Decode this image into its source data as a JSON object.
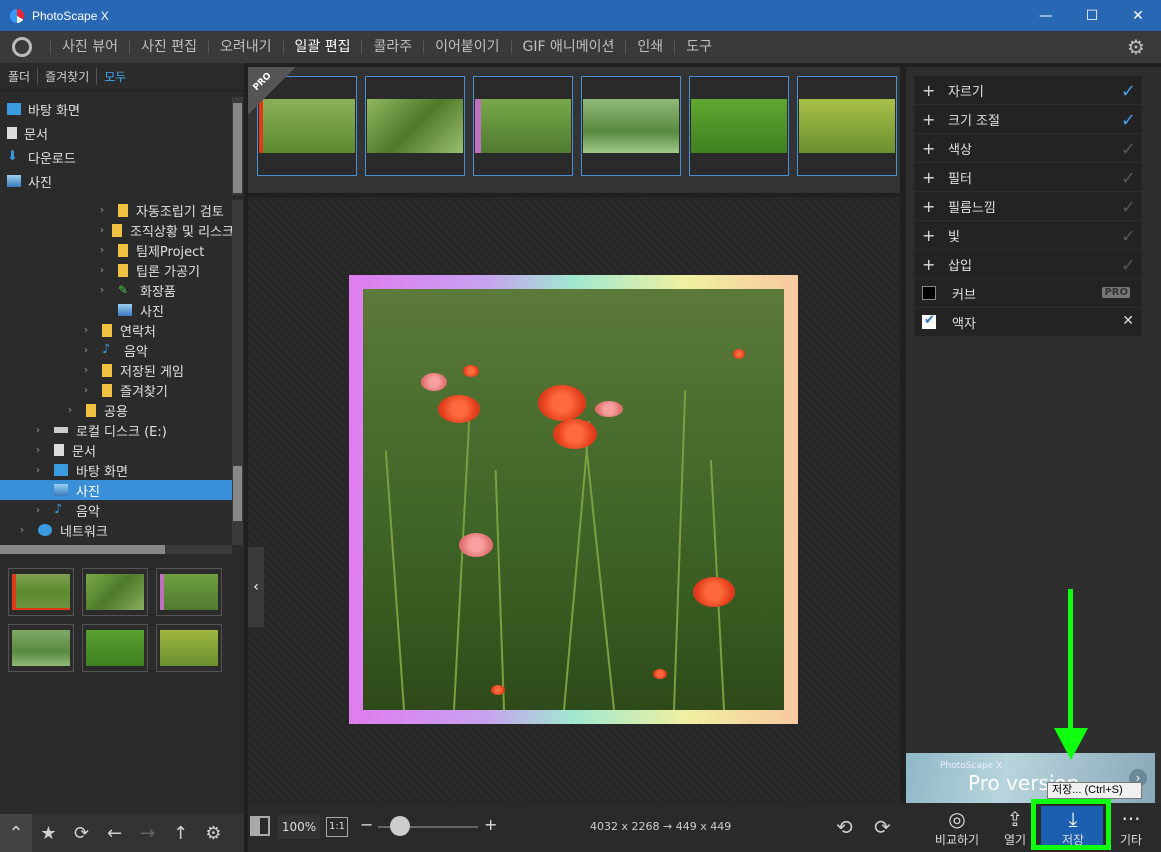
{
  "window": {
    "title": "PhotoScape X",
    "minimize": "—",
    "maximize": "☐",
    "close": "✕"
  },
  "menu": {
    "items": [
      {
        "label": "사진 뷰어"
      },
      {
        "label": "사진 편집"
      },
      {
        "label": "오려내기"
      },
      {
        "label": "일괄 편집"
      },
      {
        "label": "콜라주"
      },
      {
        "label": "이어붙이기"
      },
      {
        "label": "GIF 애니메이션"
      },
      {
        "label": "인쇄"
      },
      {
        "label": "도구"
      }
    ],
    "active": "일괄 편집"
  },
  "left": {
    "tabs": [
      "폴더",
      "즐겨찾기",
      "모두"
    ],
    "quick": [
      {
        "label": "바탕 화면",
        "icon": "desktop-icon"
      },
      {
        "label": "문서",
        "icon": "document-icon"
      },
      {
        "label": "다운로드",
        "icon": "download-icon"
      },
      {
        "label": "사진",
        "icon": "pictures-icon"
      }
    ],
    "tree": [
      {
        "label": "자동조립기 검토",
        "indent": 6
      },
      {
        "label": "조직상황 및 리스크",
        "indent": 6
      },
      {
        "label": "팀제Project",
        "indent": 6
      },
      {
        "label": "팁론 가공기",
        "indent": 6
      },
      {
        "label": "화장품",
        "indent": 6
      },
      {
        "label": "사진",
        "indent": 5
      },
      {
        "label": "연락처",
        "indent": 5
      },
      {
        "label": "음악",
        "indent": 5
      },
      {
        "label": "저장된 게임",
        "indent": 5
      },
      {
        "label": "즐겨찾기",
        "indent": 5
      },
      {
        "label": "공용",
        "indent": 4
      },
      {
        "label": "로컬 디스크 (E:)",
        "indent": 2
      },
      {
        "label": "문서",
        "indent": 2
      },
      {
        "label": "바탕 화면",
        "indent": 2
      },
      {
        "label": "사진",
        "indent": 2
      },
      {
        "label": "음악",
        "indent": 2
      },
      {
        "label": "네트워크",
        "indent": 1
      }
    ]
  },
  "adjustments": [
    {
      "label": "자르기",
      "checked": true
    },
    {
      "label": "크기 조절",
      "checked": true
    },
    {
      "label": "색상",
      "checked": false
    },
    {
      "label": "필터",
      "checked": false
    },
    {
      "label": "필름느낌",
      "checked": false
    },
    {
      "label": "빛",
      "checked": false
    },
    {
      "label": "삽입",
      "checked": false
    }
  ],
  "curve": {
    "label": "커브",
    "badge": "PRO"
  },
  "frame_option": {
    "label": "액자"
  },
  "pro_banner": {
    "small": "PhotoScape X",
    "big": "Pro version"
  },
  "bottom": {
    "zoom": "100%",
    "one_to_one": "1:1",
    "dimensions": "4032 x 2268 → 449 x 449",
    "compare": "비교하기",
    "open": "열기",
    "save": "저장",
    "more": "기타",
    "tooltip": "저장... (Ctrl+S)"
  },
  "film_badge": "PRO"
}
